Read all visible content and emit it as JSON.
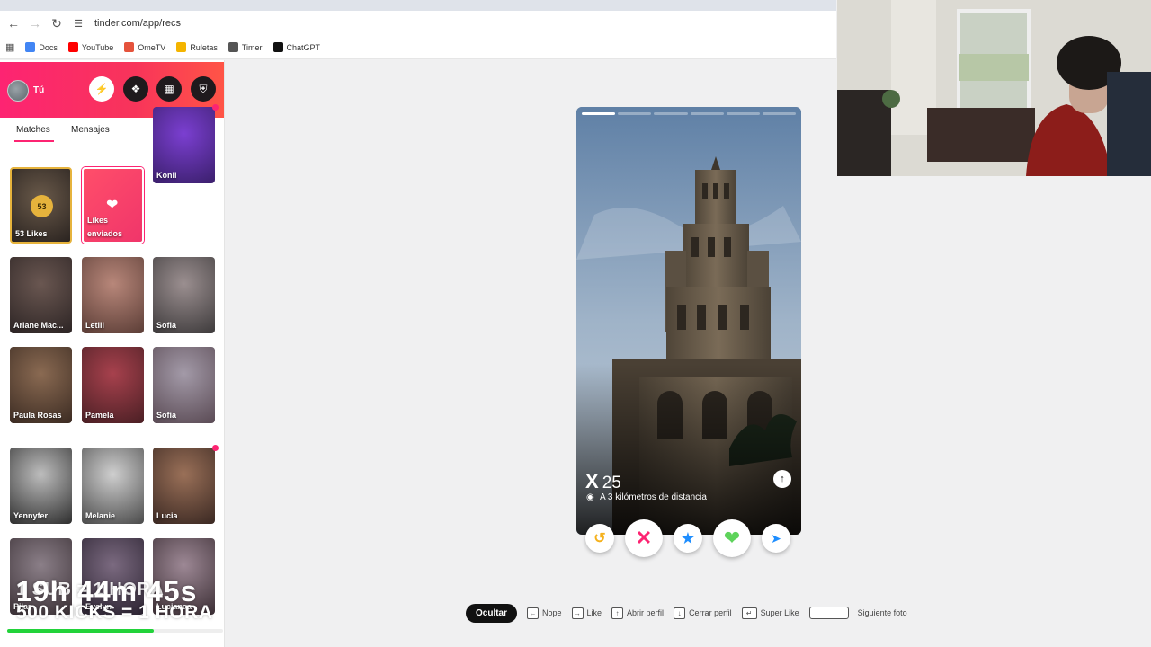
{
  "browser": {
    "url": "tinder.com/app/recs",
    "bookmarks": [
      {
        "label": "Docs",
        "color": "#4285f4"
      },
      {
        "label": "YouTube",
        "color": "#ff0000"
      },
      {
        "label": "OmeTV",
        "color": "#e5533c"
      },
      {
        "label": "Ruletas",
        "color": "#f4b400"
      },
      {
        "label": "Timer",
        "color": "#555555"
      },
      {
        "label": "ChatGPT",
        "color": "#111111"
      }
    ]
  },
  "sidebar": {
    "user_label": "Tú",
    "accent": "#fd2472",
    "tabs": {
      "matches": "Matches",
      "mensajes": "Mensajes"
    },
    "likes": {
      "count": "53",
      "label": "53 Likes"
    },
    "likes_sent": {
      "label_line1": "Likes",
      "label_line2": "enviados"
    },
    "matches": [
      {
        "name": "Konii"
      },
      {
        "name": "Ariane Mac..."
      },
      {
        "name": "Letiii"
      },
      {
        "name": "Sofia"
      },
      {
        "name": "Paula Rosas"
      },
      {
        "name": "Pamela"
      },
      {
        "name": "Sofia"
      },
      {
        "name": "Yennyfer"
      },
      {
        "name": "Melanie"
      },
      {
        "name": "Lucia"
      },
      {
        "name": "Pilar"
      },
      {
        "name": "Evelyn"
      },
      {
        "name": "Lucianaa"
      }
    ]
  },
  "overlay": {
    "line1": "1 SUB = 1 HORA",
    "line2": "500 KICKS = 1 HORA",
    "timer": "19h 44m 45s",
    "progress": 0.68
  },
  "profile": {
    "name": "X",
    "age": "25",
    "distance": "A 3 kilómetros de distancia",
    "photo_count": 6,
    "active_photo": 0
  },
  "shortcuts": {
    "hide": "Ocultar",
    "nope": "Nope",
    "like": "Like",
    "open_profile": "Abrir perfil",
    "close_profile": "Cerrar perfil",
    "super_like": "Super Like",
    "next_photo": "Siguiente foto"
  }
}
